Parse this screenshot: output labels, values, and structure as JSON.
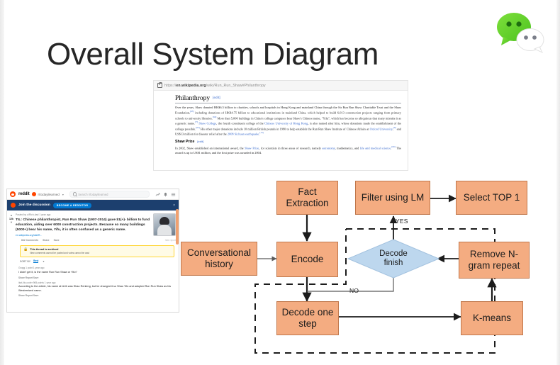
{
  "slide": {
    "title": "Overall System Diagram",
    "background_color": "#ffffff",
    "logo": "wechat-logo"
  },
  "wikipedia_screenshot": {
    "url_prefix": "https://",
    "url_domain": "en.wikipedia.org",
    "url_path": "/wiki/Run_Run_Shaw#Philanthropy",
    "lock_icon": "lock-icon",
    "section1_heading": "Philanthropy",
    "edit_label": "[edit]",
    "section1_paragraph": "Over the years, Shaw donated HK$6.5 billion to charities, schools and hospitals in Hong Kong and mainland China through the Sir Run Run Shaw Charitable Trust and the Shaw Foundation,[63] including donations of HK$4.75 billion to educational institutions in mainland China, which helped to build 6,013 construction projects ranging from primary schools to university libraries.[64] More than 5,000 buildings in China's college campuses bear Shaw's Chinese name, \"Yifu\", which has become so ubiquitous that many mistake it as a generic name.[7] Shaw College, the fourth constituent college of the Chinese University of Hong Kong, is also named after him, whose donations made the establishment of the college possible.[65] His other major donations include 10 million British pounds in 1990 to help establish the Run Run Shaw Institute of Chinese Affairs at Oxford University,[9] and US$13 million for disaster relief after the 2008 Sichuan earthquake.[13]",
    "section2_heading": "Shaw Prize",
    "section2_paragraph": "In 2002, Shaw established an international award, the Shaw Prize, for scientists in three areas of research, namely astronomy, mathematics, and life and medical science.[66] The award is up to US$1 million, and the first prize was awarded in 2004."
  },
  "reddit_screenshot": {
    "brand": "reddit",
    "subreddit": "r/todayilearned",
    "search_placeholder": "Search r/todayilearned",
    "chevron_icon": "chevron-down-icon",
    "search_icon": "search-icon",
    "trending_icon": "trending-icon",
    "notifications_icon": "bell-icon",
    "menu_icon": "hamburger-menu-icon",
    "banner_title": "Join the discussion",
    "banner_button": "BECOME A REDDITOR",
    "banner_close_icon": "close-icon",
    "post_meta": "Posted by u/Rich-dad 1 year ago",
    "post_score": "12k",
    "upvote_icon": "upvote-arrow-icon",
    "downvote_icon": "downvote-arrow-icon",
    "post_title": "TIL: Chinese philanthropist, Run Run Shaw (1907-2014) gave $1(+)- billion to fund education, aiding over 6000 construction projects. Because so many buildings (5000+) bear his name, Yifu, it is often confused as a generic name.",
    "post_link": "en.wikipedia.org/wiki/R...",
    "link_icon": "external-link-icon",
    "actions": [
      "832 Comments",
      "Share",
      "Save"
    ],
    "actions_right": "hide  report",
    "notice_icon": "lock-icon",
    "notice_title": "This thread is archived",
    "notice_subtitle": "New comments cannot be posted and votes cannot be cast",
    "sort_label": "SORT BY",
    "sort_value": "Best",
    "sort_chevron_icon": "chevron-down-icon",
    "comments": [
      {
        "meta": "Grogg  1 point  1 year ago",
        "text": "I didn't get it, is the name Run Run Shaw or Yifu?",
        "actions": "Share  Report  Save"
      },
      {
        "meta": "ikat-lito-coder  965 points  1 year ago",
        "text": "According to the article, his name at birth was Shao Renleng, but he changed it so Shao Yifu and adopted Run Run Shaw as his Westernized name.",
        "actions": "Share  Report  Save"
      }
    ],
    "scrollbar": "vertical-scrollbar"
  },
  "flowchart": {
    "colors": {
      "process_fill": "#F4AC81",
      "process_border": "#C0774B",
      "decision_fill": "#BDD7EE",
      "decision_border": "#9BB9D6",
      "arrow": "#1c1c1c"
    },
    "nodes": {
      "fact_extraction": "Fact Extraction",
      "fact_extraction_l1": "Fact",
      "fact_extraction_l2": "Extraction",
      "filter_using_lm": "Filter using LM",
      "select_top_1": "Select TOP 1",
      "conversational_history_l1": "Conversational",
      "conversational_history_l2": "history",
      "encode": "Encode",
      "decode_finish_l1": "Decode",
      "decode_finish_l2": "finish",
      "remove_ngram_l1": "Remove N-",
      "remove_ngram_l2": "gram repeat",
      "decode_one_step_l1": "Decode one",
      "decode_one_step_l2": "step",
      "k_means": "K-means"
    },
    "edge_labels": {
      "yes": "YES",
      "no": "NO"
    }
  }
}
